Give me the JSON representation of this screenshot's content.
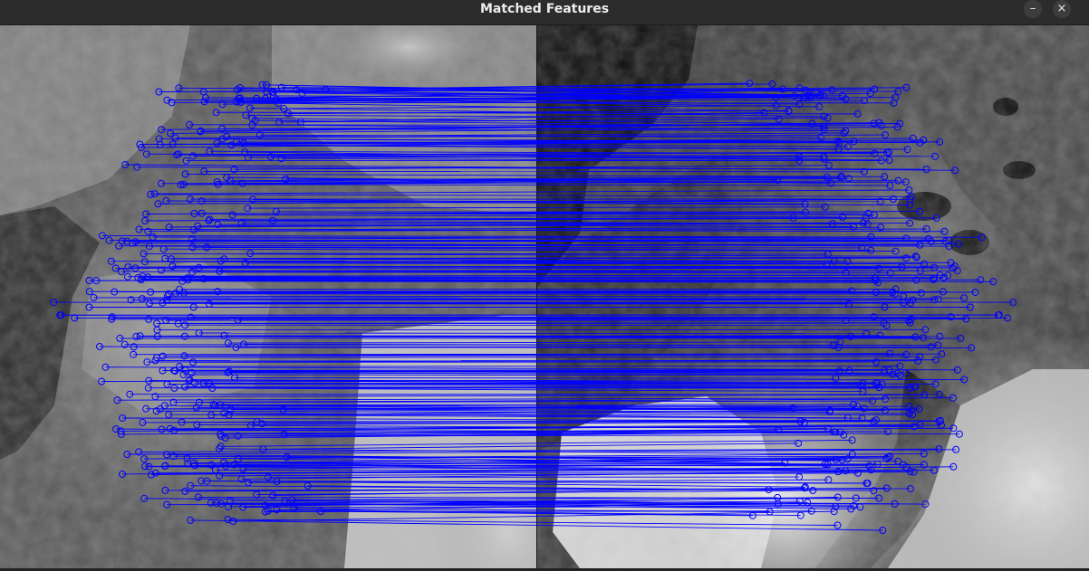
{
  "window": {
    "title": "Matched Features",
    "minimize_label": "–",
    "close_label": "×"
  },
  "viewer": {
    "match_line_color": "#0000ff",
    "keypoint_color": "#0000ff",
    "left_image": "grayscale satellite image of ice and coastline",
    "right_image": "satellite image of coastline, dark water and cloud cover"
  },
  "icons": {
    "minimize": "minimize-icon",
    "close": "close-icon"
  }
}
